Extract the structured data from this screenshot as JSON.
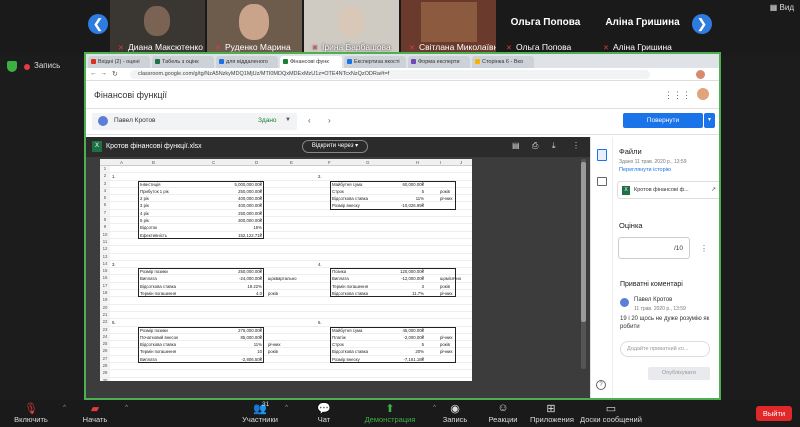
{
  "top_right": {
    "view_label": "Вид"
  },
  "recording": {
    "label": "Запись"
  },
  "participants": [
    {
      "name": "Диана Максютенко"
    },
    {
      "name": "Руденко Марина"
    },
    {
      "name": "Ірина Барбашова"
    },
    {
      "name": "Світлана Миколаївна"
    },
    {
      "name": "Ольга Попова",
      "big": "Ольга Попова"
    },
    {
      "name": "Аліна Гришина",
      "big": "Аліна Гришина"
    }
  ],
  "browser": {
    "tabs": [
      "Вхідні (2) - оцені",
      "Табель з оцінк",
      "для віддаленого",
      "Фінансові функ",
      "Експертиза якості",
      "Форма експерти",
      "Сторінка 6 - Вко"
    ],
    "url": "classroom.google.com/g/tg/NzA5NzkyMDQ1MjUz/MTI0MDQxMDExMzU1z=OTE4NTcxNzQzODRa#t=f"
  },
  "classroom": {
    "title": "Фінансові функції",
    "student_name": "Павел Кротов",
    "student_status": "Здано",
    "return_label": "Повернути"
  },
  "viewer": {
    "file_name": "Кротов фінансові функції.xlsx",
    "open_with": "Відкрити через"
  },
  "sheet": {
    "columns": [
      "A",
      "B",
      "C",
      "D",
      "E",
      "F",
      "G",
      "H",
      "I",
      "J"
    ],
    "rows": [
      "1",
      "2",
      "3",
      "4",
      "5",
      "6",
      "7",
      "8",
      "9",
      "10",
      "11",
      "12",
      "13",
      "14",
      "15",
      "16",
      "17",
      "18",
      "19",
      "20",
      "21",
      "22",
      "23",
      "24",
      "25",
      "26",
      "27",
      "28",
      "29",
      "30"
    ],
    "block1": {
      "num": "1.",
      "labels": [
        "Інвестиція",
        "Прибуток 1 рік",
        "2 рік",
        "3 рік",
        "4 рік",
        "5 рік",
        "Відсоток",
        "Ефективність"
      ],
      "values": [
        "5,000,000.00₴",
        "250,000.00₴",
        "400,000.00₴",
        "400,000.00₴",
        "250,000.00₴",
        "300,000.00₴",
        "15%",
        "152,122.71₴"
      ]
    },
    "block2": {
      "num": "2.",
      "labels": [
        "Майбутня сума",
        "Строк",
        "Відсоткова ставка",
        "Розмір внеску"
      ],
      "values": [
        "60,000.00₴",
        "5",
        "11%",
        "-10,026.99₴"
      ],
      "units": [
        "",
        "років",
        "річних",
        ""
      ]
    },
    "block3": {
      "num": "3.",
      "labels": [
        "Розмір позики",
        "Виплата",
        "Відсоткова ставка",
        "Термін погашення"
      ],
      "values": [
        "250,000.00₴",
        "-24,000.00₴",
        "19.22%",
        "4.0"
      ],
      "units": [
        "",
        "щоквартально",
        "",
        "років"
      ]
    },
    "block4": {
      "num": "4.",
      "labels": [
        "Позика",
        "Виплата",
        "Термін погашення",
        "Відсоткова ставка"
      ],
      "values": [
        "120,000.00₴",
        "-12,000.00₴",
        "3",
        "11.7%"
      ],
      "units": [
        "",
        "щомісячно",
        "років",
        "річних"
      ]
    },
    "block5": {
      "num": "5.",
      "labels": [
        "Розмір позики",
        "Початковий внесок",
        "Відсоткова ставка",
        "Термін погашення",
        "Виплата"
      ],
      "values": [
        "275,000.00₴",
        "85,000.00₴",
        "11%",
        "10",
        "-2,806.50₴"
      ],
      "units": [
        "",
        "",
        "річних",
        "років",
        ""
      ]
    },
    "block6": {
      "num": "6.",
      "labels": [
        "Майбутня сума",
        "Платіж",
        "Строк",
        "Відсоткова ставка",
        "Розмір внеску"
      ],
      "values": [
        "45,000.00₴",
        "-2,000.00₴",
        "5",
        "20%",
        "-7,161.18₴"
      ],
      "units": [
        "",
        "річних",
        "років",
        "річних",
        ""
      ]
    }
  },
  "side_panel": {
    "files_title": "Файли",
    "submitted": "Здано 11 трав. 2020 р., 13:59",
    "view_history": "Переглянути історію",
    "file_name": "Кротов фінансові ф...",
    "grade_title": "Оцінка",
    "grade_denominator": "/10",
    "private_title": "Приватні коментарі",
    "comment_author": "Павел Кротов",
    "comment_time": "11 трав. 2020 р., 13:59",
    "comment_text": "19 і 20 щось не дуже розумію як робити",
    "input_placeholder": "Додайте приватний ко...",
    "publish": "Опублікувати"
  },
  "toolbar": {
    "mute": "Включить звук",
    "video": "Начать видео",
    "participants": "Участники",
    "participants_count": "31",
    "chat": "Чат",
    "share": "Демонстрация экрана",
    "record": "Запись",
    "reactions": "Реакции",
    "apps": "Приложения",
    "whiteboard": "Доски сообщений",
    "leave": "Выйти"
  }
}
